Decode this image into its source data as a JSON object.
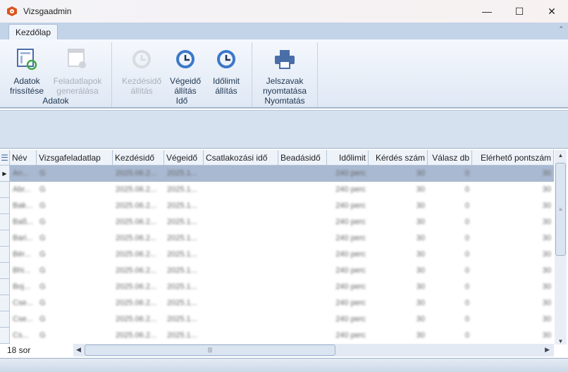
{
  "window": {
    "title": "Vizsgaadmin",
    "minimize": "—",
    "maximize": "☐",
    "close": "✕"
  },
  "ribbon": {
    "tab": "Kezdőlap",
    "collapse": "⌃",
    "groups": [
      {
        "label": "Adatok"
      },
      {
        "label": "Idő"
      },
      {
        "label": "Nyomtatás"
      }
    ],
    "buttons": [
      {
        "l1": "Adatok",
        "l2": "frissítése",
        "icon": "refresh-data-icon",
        "enabled": true
      },
      {
        "l1": "Feladatlapok",
        "l2": "generálása",
        "icon": "generate-sheets-icon",
        "enabled": false
      },
      {
        "l1": "Kezdésidő",
        "l2": "állítás",
        "icon": "history-clock-icon",
        "enabled": false
      },
      {
        "l1": "Végeidő",
        "l2": "állítás",
        "icon": "history-clock-icon",
        "enabled": true
      },
      {
        "l1": "Időlimit",
        "l2": "állítás",
        "icon": "history-clock-icon",
        "enabled": true
      },
      {
        "l1": "Jelszavak",
        "l2": "nyomtatása",
        "icon": "printer-icon",
        "enabled": true
      }
    ]
  },
  "grid": {
    "columns": [
      "Név",
      "Vizsgafeladatlap",
      "Kezdésidő",
      "Végeidő",
      "Csatlakozási idő",
      "Beadásidő",
      "Időlimit",
      "Kérdés szám",
      "Válasz db",
      "Elérhető pontszám"
    ],
    "rows": [
      [
        "An...",
        "G",
        "2025.06.2...",
        "2025.1...",
        "",
        "",
        "240 perc",
        "30",
        "0",
        "30"
      ],
      [
        "Abr...",
        "G",
        "2025.06.2...",
        "2025.1...",
        "",
        "",
        "240 perc",
        "30",
        "0",
        "30"
      ],
      [
        "Bak...",
        "G",
        "2025.06.2...",
        "2025.1...",
        "",
        "",
        "240 perc",
        "30",
        "0",
        "30"
      ],
      [
        "Baß...",
        "G",
        "2025.06.2...",
        "2025.1...",
        "",
        "",
        "240 perc",
        "30",
        "0",
        "30"
      ],
      [
        "Bari...",
        "G",
        "2025.06.2...",
        "2025.1...",
        "",
        "",
        "240 perc",
        "30",
        "0",
        "30"
      ],
      [
        "Bér...",
        "G",
        "2025.06.2...",
        "2025.1...",
        "",
        "",
        "240 perc",
        "30",
        "0",
        "30"
      ],
      [
        "Bhi...",
        "G",
        "2025.06.2...",
        "2025.1...",
        "",
        "",
        "240 perc",
        "30",
        "0",
        "30"
      ],
      [
        "Boj...",
        "G",
        "2025.06.2...",
        "2025.1...",
        "",
        "",
        "240 perc",
        "30",
        "0",
        "30"
      ],
      [
        "Cse...",
        "G",
        "2025.06.2...",
        "2025.1...",
        "",
        "",
        "240 perc",
        "30",
        "0",
        "30"
      ],
      [
        "Cse...",
        "G",
        "2025.06.2...",
        "2025.1...",
        "",
        "",
        "240 perc",
        "30",
        "0",
        "30"
      ],
      [
        "Cs...",
        "G",
        "2025.06.2...",
        "2025.1...",
        "",
        "",
        "240 perc",
        "30",
        "0",
        "30"
      ]
    ],
    "row_count": "18 sor"
  }
}
